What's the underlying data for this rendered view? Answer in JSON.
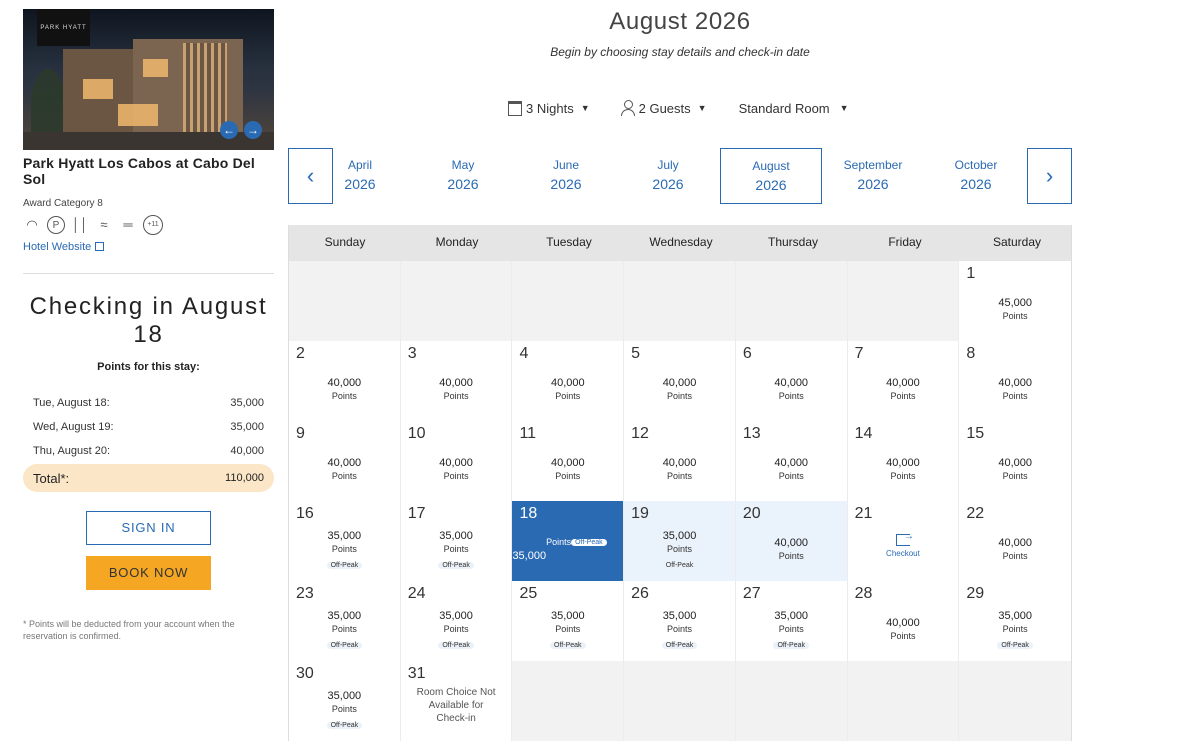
{
  "hotel": {
    "logo_text": "PARK HYATT",
    "name": "Park Hyatt Los Cabos at Cabo Del Sol",
    "award_category": "Award Category 8",
    "amenities_more": "+11",
    "website_label": "Hotel Website",
    "amenity_icons": [
      "wifi-icon",
      "parking-icon",
      "dining-icon",
      "spa-icon",
      "fitness-icon"
    ]
  },
  "stay": {
    "title": "Checking in August 18",
    "points_label": "Points for this stay:",
    "nights": [
      {
        "label": "Tue, August 18:",
        "value": "35,000"
      },
      {
        "label": "Wed, August 19:",
        "value": "35,000"
      },
      {
        "label": "Thu, August 20:",
        "value": "40,000"
      }
    ],
    "total_label": "Total*:",
    "total_value": "110,000",
    "sign_in": "SIGN IN",
    "book_now": "BOOK NOW",
    "footnote": "* Points will be deducted from your account when the reservation is confirmed."
  },
  "header": {
    "title": "August 2026",
    "subtitle": "Begin by choosing stay details and check-in date",
    "nights": "3 Nights",
    "guests": "2 Guests",
    "room": "Standard Room"
  },
  "months": [
    {
      "name": "April",
      "year": "2026"
    },
    {
      "name": "May",
      "year": "2026"
    },
    {
      "name": "June",
      "year": "2026"
    },
    {
      "name": "July",
      "year": "2026"
    },
    {
      "name": "August",
      "year": "2026",
      "active": true
    },
    {
      "name": "September",
      "year": "2026"
    },
    {
      "name": "October",
      "year": "2026"
    }
  ],
  "weekdays": [
    "Sunday",
    "Monday",
    "Tuesday",
    "Wednesday",
    "Thursday",
    "Friday",
    "Saturday"
  ],
  "points_unit": "Points",
  "offpeak_label": "Off-Peak",
  "checkout_label": "Checkout",
  "calendar": [
    [
      null,
      null,
      null,
      null,
      null,
      null,
      {
        "day": "1",
        "points": "45,000"
      }
    ],
    [
      {
        "day": "2",
        "points": "40,000"
      },
      {
        "day": "3",
        "points": "40,000"
      },
      {
        "day": "4",
        "points": "40,000"
      },
      {
        "day": "5",
        "points": "40,000"
      },
      {
        "day": "6",
        "points": "40,000"
      },
      {
        "day": "7",
        "points": "40,000"
      },
      {
        "day": "8",
        "points": "40,000"
      }
    ],
    [
      {
        "day": "9",
        "points": "40,000"
      },
      {
        "day": "10",
        "points": "40,000"
      },
      {
        "day": "11",
        "points": "40,000"
      },
      {
        "day": "12",
        "points": "40,000"
      },
      {
        "day": "13",
        "points": "40,000"
      },
      {
        "day": "14",
        "points": "40,000"
      },
      {
        "day": "15",
        "points": "40,000"
      }
    ],
    [
      {
        "day": "16",
        "points": "35,000",
        "offpeak": true
      },
      {
        "day": "17",
        "points": "35,000",
        "offpeak": true
      },
      {
        "day": "18",
        "points": "35,000",
        "offpeak": true,
        "state": "selected"
      },
      {
        "day": "19",
        "points": "35,000",
        "offpeak": true,
        "state": "range"
      },
      {
        "day": "20",
        "points": "40,000",
        "state": "range"
      },
      {
        "day": "21",
        "state": "checkout"
      },
      {
        "day": "22",
        "points": "40,000"
      }
    ],
    [
      {
        "day": "23",
        "points": "35,000",
        "offpeak": true
      },
      {
        "day": "24",
        "points": "35,000",
        "offpeak": true
      },
      {
        "day": "25",
        "points": "35,000",
        "offpeak": true
      },
      {
        "day": "26",
        "points": "35,000",
        "offpeak": true
      },
      {
        "day": "27",
        "points": "35,000",
        "offpeak": true
      },
      {
        "day": "28",
        "points": "40,000"
      },
      {
        "day": "29",
        "points": "35,000",
        "offpeak": true
      }
    ],
    [
      {
        "day": "30",
        "points": "35,000",
        "offpeak": true
      },
      {
        "day": "31",
        "unavailable": "Room Choice Not Available for Check-in"
      },
      null,
      null,
      null,
      null,
      null
    ]
  ]
}
